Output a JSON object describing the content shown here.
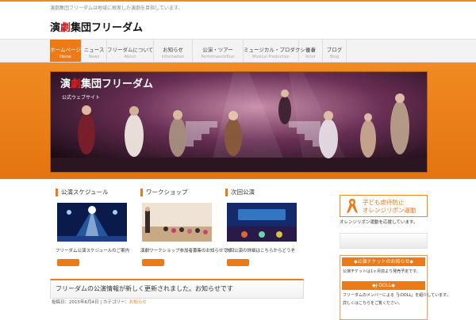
{
  "header": {
    "tagline": "演劇集団フリーダムは地域に根差した演劇を目指しています。",
    "logo_prefix": "演",
    "logo_accent": "劇",
    "logo_suffix": "集団フリーダム"
  },
  "nav": {
    "items": [
      {
        "jp": "ホームページ",
        "en": "Home"
      },
      {
        "jp": "ニュース",
        "en": "News"
      },
      {
        "jp": "フリーダムについて",
        "en": "About"
      },
      {
        "jp": "お知らせ",
        "en": "Information"
      },
      {
        "jp": "公演・ツアー",
        "en": "PerformanceTour"
      },
      {
        "jp": "ミュージカル・プロダクション",
        "en": "Musical Production"
      },
      {
        "jp": "役者",
        "en": "Actor"
      },
      {
        "jp": "ブログ",
        "en": "Blog"
      }
    ]
  },
  "hero": {
    "title_prefix": "演",
    "title_accent": "劇",
    "title_suffix": "集団フリーダム",
    "subtitle": "公式ウェブサイト"
  },
  "columns": [
    {
      "title": "公演スケジュール",
      "text": "フリーダム公演スケジュールのご案内",
      "image": "stage-lights"
    },
    {
      "title": "ワークショップ",
      "text": "演劇ワークショップ参加者募集のお知らせです",
      "image": "workshop-room"
    },
    {
      "title": "次回公演",
      "text": "次回公演の詳細はこちらからどうぞ",
      "image": "kusoo-poster"
    }
  ],
  "sidebar": {
    "ribbon_line1": "子ども虐待防止",
    "ribbon_line2": "オレンジリボン運動",
    "ribbon_caption": "オレンジリボン運動を応援しています。",
    "box_heading1": "◆公演チケットのお知らせ◆",
    "box_text1": "公演チケットは1ヶ月前より発売予定です。",
    "box_heading2": "◆J-DOLL◆",
    "box_text2": "フリーダムのメンバーによる「J-DOLL」を紹介しています。",
    "box_text3": "詳しくはこちらをご覧ください。"
  },
  "post": {
    "title": "フリーダムの公演情報が新しく更新されました。お知らせです",
    "meta_prefix": "投稿日：",
    "date": "2015年6月4日",
    "meta_sep": " | カテゴリー：",
    "category": "お知らせ"
  },
  "colors": {
    "accent": "#ec7a16",
    "logo_red": "#d0161b"
  }
}
